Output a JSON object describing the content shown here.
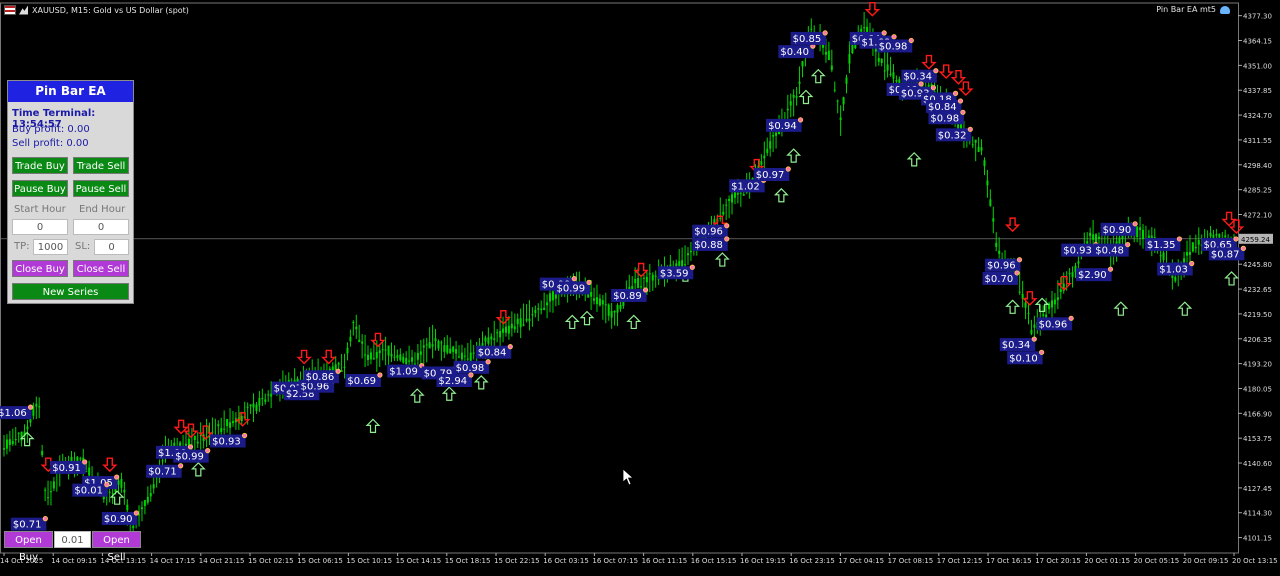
{
  "window": {
    "symbol_title": "XAUUSD, M15:  Gold vs US Dollar (spot)",
    "ea_name": "Pin Bar EA mt5"
  },
  "panel": {
    "title": "Pin Bar EA",
    "time_label": "Time Terminal: 13:54:57",
    "buy_profit": "Buy profit: 0.00",
    "sell_profit": "Sell profit: 0.00",
    "trade_buy": "Trade Buy",
    "trade_sell": "Trade Sell",
    "pause_buy": "Pause Buy",
    "pause_sell": "Pause Sell",
    "start_hour_label": "Start Hour",
    "end_hour_label": "End Hour",
    "start_hour_value": "0",
    "end_hour_value": "0",
    "tp_label": "TP:",
    "tp_value": "1000",
    "sl_label": "SL:",
    "sl_value": "0",
    "close_buy": "Close Buy",
    "close_sell": "Close Sell",
    "new_series": "New Series"
  },
  "bottom": {
    "open_buy": "Open Buy",
    "lot_value": "0.01",
    "open_sell": "Open Sell"
  },
  "colors": {
    "candle": "#00d400",
    "panel_header": "#1f22e0",
    "green_button": "#0a8a14",
    "purple_button": "#b13ad6",
    "label_bg": "#1b1b8a",
    "down_arrow": "#ff1a1a",
    "up_arrow": "#90ee90"
  },
  "chart_data": {
    "type": "candlestick",
    "symbol": "XAUUSD",
    "timeframe": "M15",
    "ylim": [
      4093.0,
      4384.0
    ],
    "y_ticks": [
      4377.3,
      4364.15,
      4351.0,
      4337.85,
      4324.7,
      4311.55,
      4298.4,
      4285.25,
      4272.1,
      4259.24,
      4245.8,
      4232.65,
      4219.5,
      4206.35,
      4193.2,
      4180.05,
      4166.9,
      4153.75,
      4140.6,
      4127.45,
      4114.3,
      4101.15
    ],
    "current_price": "4259.24",
    "x_ticks": [
      "14 Oct 2025",
      "14 Oct 09:15",
      "14 Oct 13:15",
      "14 Oct 17:15",
      "14 Oct 21:15",
      "15 Oct 02:15",
      "15 Oct 06:15",
      "15 Oct 10:15",
      "15 Oct 14:15",
      "15 Oct 18:15",
      "15 Oct 22:15",
      "16 Oct 03:15",
      "16 Oct 07:15",
      "16 Oct 11:15",
      "16 Oct 15:15",
      "16 Oct 19:15",
      "16 Oct 23:15",
      "17 Oct 04:15",
      "17 Oct 08:15",
      "17 Oct 12:15",
      "17 Oct 16:15",
      "17 Oct 20:15",
      "20 Oct 01:15",
      "20 Oct 05:15",
      "20 Oct 09:15",
      "20 Oct 13:15"
    ],
    "price_path": [
      [
        0,
        4150
      ],
      [
        0.4,
        4155
      ],
      [
        0.7,
        4175
      ],
      [
        0.85,
        4120
      ],
      [
        1.2,
        4140
      ],
      [
        1.6,
        4142
      ],
      [
        2.0,
        4124
      ],
      [
        2.4,
        4130
      ],
      [
        2.6,
        4104
      ],
      [
        2.9,
        4120
      ],
      [
        3.3,
        4148
      ],
      [
        3.7,
        4150
      ],
      [
        4.1,
        4155
      ],
      [
        4.6,
        4162
      ],
      [
        5.1,
        4170
      ],
      [
        5.5,
        4180
      ],
      [
        6.0,
        4184
      ],
      [
        6.4,
        4188
      ],
      [
        6.9,
        4192
      ],
      [
        7.1,
        4214
      ],
      [
        7.4,
        4196
      ],
      [
        7.8,
        4200
      ],
      [
        8.3,
        4194
      ],
      [
        8.7,
        4205
      ],
      [
        9.1,
        4200
      ],
      [
        9.5,
        4197
      ],
      [
        9.9,
        4207
      ],
      [
        10.3,
        4212
      ],
      [
        10.8,
        4220
      ],
      [
        11.2,
        4230
      ],
      [
        11.6,
        4236
      ],
      [
        12.0,
        4228
      ],
      [
        12.4,
        4219
      ],
      [
        12.8,
        4235
      ],
      [
        13.3,
        4240
      ],
      [
        13.8,
        4246
      ],
      [
        14.3,
        4262
      ],
      [
        14.7,
        4278
      ],
      [
        15.2,
        4288
      ],
      [
        15.6,
        4310
      ],
      [
        16.1,
        4335
      ],
      [
        16.4,
        4372
      ],
      [
        16.8,
        4355
      ],
      [
        17.0,
        4320
      ],
      [
        17.2,
        4358
      ],
      [
        17.5,
        4373
      ],
      [
        17.8,
        4354
      ],
      [
        18.3,
        4338
      ],
      [
        18.7,
        4344
      ],
      [
        19.1,
        4332
      ],
      [
        19.5,
        4315
      ],
      [
        19.9,
        4305
      ],
      [
        20.2,
        4252
      ],
      [
        20.6,
        4238
      ],
      [
        20.9,
        4210
      ],
      [
        21.3,
        4225
      ],
      [
        21.7,
        4240
      ],
      [
        22.1,
        4262
      ],
      [
        22.5,
        4252
      ],
      [
        22.9,
        4265
      ],
      [
        23.4,
        4258
      ],
      [
        23.8,
        4238
      ],
      [
        24.2,
        4257
      ],
      [
        24.6,
        4260
      ],
      [
        25.0,
        4258
      ]
    ],
    "trade_labels": [
      {
        "text": "$1.06",
        "x": 0.2,
        "y": 4167
      },
      {
        "text": "$0.71",
        "x": 0.5,
        "y": 4108
      },
      {
        "text": "$0.91",
        "x": 1.3,
        "y": 4138
      },
      {
        "text": "$1.05",
        "x": 1.95,
        "y": 4130
      },
      {
        "text": "$0.01",
        "x": 1.75,
        "y": 4126
      },
      {
        "text": "$0.90",
        "x": 2.35,
        "y": 4111
      },
      {
        "text": "$0.71",
        "x": 3.25,
        "y": 4136
      },
      {
        "text": "$1.00",
        "x": 3.45,
        "y": 4146
      },
      {
        "text": "$0.99",
        "x": 3.8,
        "y": 4144
      },
      {
        "text": "$0.93",
        "x": 4.55,
        "y": 4152
      },
      {
        "text": "$0.97",
        "x": 5.8,
        "y": 4180
      },
      {
        "text": "$2.58",
        "x": 6.05,
        "y": 4177
      },
      {
        "text": "$0.96",
        "x": 6.35,
        "y": 4181
      },
      {
        "text": "$0.86",
        "x": 6.45,
        "y": 4186
      },
      {
        "text": "$0.69",
        "x": 7.3,
        "y": 4184
      },
      {
        "text": "$1.09",
        "x": 8.15,
        "y": 4189
      },
      {
        "text": "$0.79",
        "x": 8.85,
        "y": 4188
      },
      {
        "text": "$0.98",
        "x": 9.5,
        "y": 4191
      },
      {
        "text": "$2.94",
        "x": 9.15,
        "y": 4184
      },
      {
        "text": "$0.84",
        "x": 9.95,
        "y": 4199
      },
      {
        "text": "$0.00",
        "x": 11.25,
        "y": 4235
      },
      {
        "text": "$0.99",
        "x": 11.55,
        "y": 4233
      },
      {
        "text": "$0.89",
        "x": 12.7,
        "y": 4229
      },
      {
        "text": "$3.59",
        "x": 13.65,
        "y": 4241
      },
      {
        "text": "$0.96",
        "x": 14.35,
        "y": 4263
      },
      {
        "text": "$0.88",
        "x": 14.35,
        "y": 4256
      },
      {
        "text": "$1.02",
        "x": 15.1,
        "y": 4287
      },
      {
        "text": "$0.97",
        "x": 15.6,
        "y": 4293
      },
      {
        "text": "$0.94",
        "x": 15.85,
        "y": 4319
      },
      {
        "text": "$0.40",
        "x": 16.1,
        "y": 4358
      },
      {
        "text": "$0.85",
        "x": 16.35,
        "y": 4365
      },
      {
        "text": "$0.64",
        "x": 17.55,
        "y": 4365
      },
      {
        "text": "$1.68",
        "x": 17.75,
        "y": 4363
      },
      {
        "text": "$0.98",
        "x": 18.1,
        "y": 4361
      },
      {
        "text": "$0.34",
        "x": 18.6,
        "y": 4345
      },
      {
        "text": "$0.46",
        "x": 18.3,
        "y": 4338
      },
      {
        "text": "$0.93",
        "x": 18.55,
        "y": 4336
      },
      {
        "text": "$0.18",
        "x": 19.0,
        "y": 4333
      },
      {
        "text": "$0.84",
        "x": 19.1,
        "y": 4329
      },
      {
        "text": "$0.98",
        "x": 19.15,
        "y": 4323
      },
      {
        "text": "$0.32",
        "x": 19.3,
        "y": 4314
      },
      {
        "text": "$0.96",
        "x": 20.3,
        "y": 4245
      },
      {
        "text": "$0.70",
        "x": 20.25,
        "y": 4238
      },
      {
        "text": "$0.34",
        "x": 20.6,
        "y": 4203
      },
      {
        "text": "$0.10",
        "x": 20.75,
        "y": 4196
      },
      {
        "text": "$0.96",
        "x": 21.35,
        "y": 4214
      },
      {
        "text": "$2.90",
        "x": 22.15,
        "y": 4240
      },
      {
        "text": "$0.93",
        "x": 21.85,
        "y": 4253
      },
      {
        "text": "$0.48",
        "x": 22.5,
        "y": 4253
      },
      {
        "text": "$0.90",
        "x": 22.65,
        "y": 4264
      },
      {
        "text": "$1.35",
        "x": 23.55,
        "y": 4256
      },
      {
        "text": "$1.03",
        "x": 23.8,
        "y": 4243
      },
      {
        "text": "$0.65",
        "x": 24.7,
        "y": 4256
      },
      {
        "text": "$0.87",
        "x": 24.85,
        "y": 4251
      }
    ],
    "up_arrows": [
      [
        0.47,
        4153
      ],
      [
        2.3,
        4122
      ],
      [
        3.95,
        4137
      ],
      [
        7.5,
        4160
      ],
      [
        8.4,
        4176
      ],
      [
        9.05,
        4177
      ],
      [
        9.7,
        4183
      ],
      [
        11.55,
        4215
      ],
      [
        11.85,
        4217
      ],
      [
        12.8,
        4215
      ],
      [
        13.85,
        4240
      ],
      [
        14.6,
        4248
      ],
      [
        15.8,
        4282
      ],
      [
        16.05,
        4303
      ],
      [
        16.3,
        4334
      ],
      [
        16.55,
        4345
      ],
      [
        18.5,
        4301
      ],
      [
        20.5,
        4223
      ],
      [
        21.1,
        4224
      ],
      [
        22.7,
        4222
      ],
      [
        24.0,
        4222
      ],
      [
        24.95,
        4238
      ]
    ],
    "down_arrows": [
      [
        0.9,
        4140
      ],
      [
        2.15,
        4140
      ],
      [
        3.6,
        4160
      ],
      [
        3.8,
        4158
      ],
      [
        4.1,
        4157
      ],
      [
        4.85,
        4164
      ],
      [
        6.1,
        4197
      ],
      [
        6.6,
        4197
      ],
      [
        7.6,
        4206
      ],
      [
        10.15,
        4218
      ],
      [
        12.95,
        4243
      ],
      [
        14.55,
        4268
      ],
      [
        15.3,
        4298
      ],
      [
        17.65,
        4381
      ],
      [
        18.8,
        4353
      ],
      [
        19.15,
        4348
      ],
      [
        19.4,
        4345
      ],
      [
        19.55,
        4339
      ],
      [
        20.5,
        4267
      ],
      [
        20.85,
        4228
      ],
      [
        21.55,
        4236
      ],
      [
        24.9,
        4270
      ],
      [
        25.05,
        4266
      ]
    ]
  }
}
